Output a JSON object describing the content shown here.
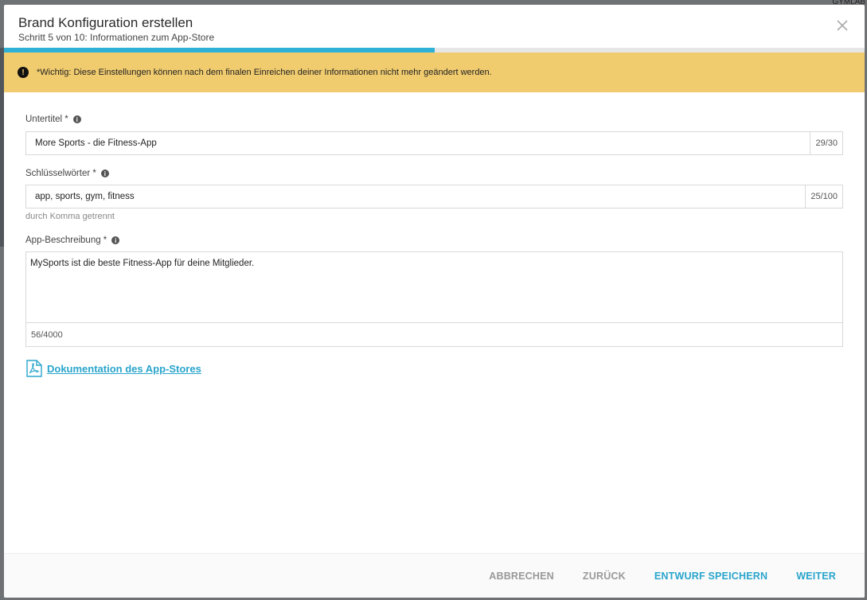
{
  "background": {
    "corner_text": "GYMLAB"
  },
  "dialog": {
    "title": "Brand Konfiguration erstellen",
    "subtitle": "Schritt 5 von 10: Informationen zum App-Store",
    "progress": {
      "current_step": 5,
      "total_steps": 10,
      "fraction": 0.5
    },
    "close_icon": "close-icon"
  },
  "warning": {
    "icon": "exclamation-circle-icon",
    "text": "*Wichtig: Diese Einstellungen können nach dem finalen Einreichen deiner Informationen nicht mehr geändert werden."
  },
  "form": {
    "subtitle_field": {
      "label": "Untertitel *",
      "value": "More Sports - die Fitness-App",
      "counter": "29/30"
    },
    "keywords_field": {
      "label": "Schlüsselwörter *",
      "value": "app, sports, gym, fitness",
      "counter": "25/100",
      "hint": "durch Komma getrennt"
    },
    "description_field": {
      "label": "App-Beschreibung *",
      "value": "MySports ist die beste Fitness-App für deine Mitglieder.",
      "counter": "56/4000"
    },
    "doc_link": {
      "label": "Dokumentation des App-Stores",
      "icon": "pdf-icon"
    }
  },
  "footer": {
    "cancel": "ABBRECHEN",
    "back": "ZURÜCK",
    "save_draft": "ENTWURF SPEICHERN",
    "next": "WEITER"
  },
  "colors": {
    "accent": "#2fb0d6",
    "warning_bg": "#f1cc6f",
    "link": "#2aa5cc"
  }
}
